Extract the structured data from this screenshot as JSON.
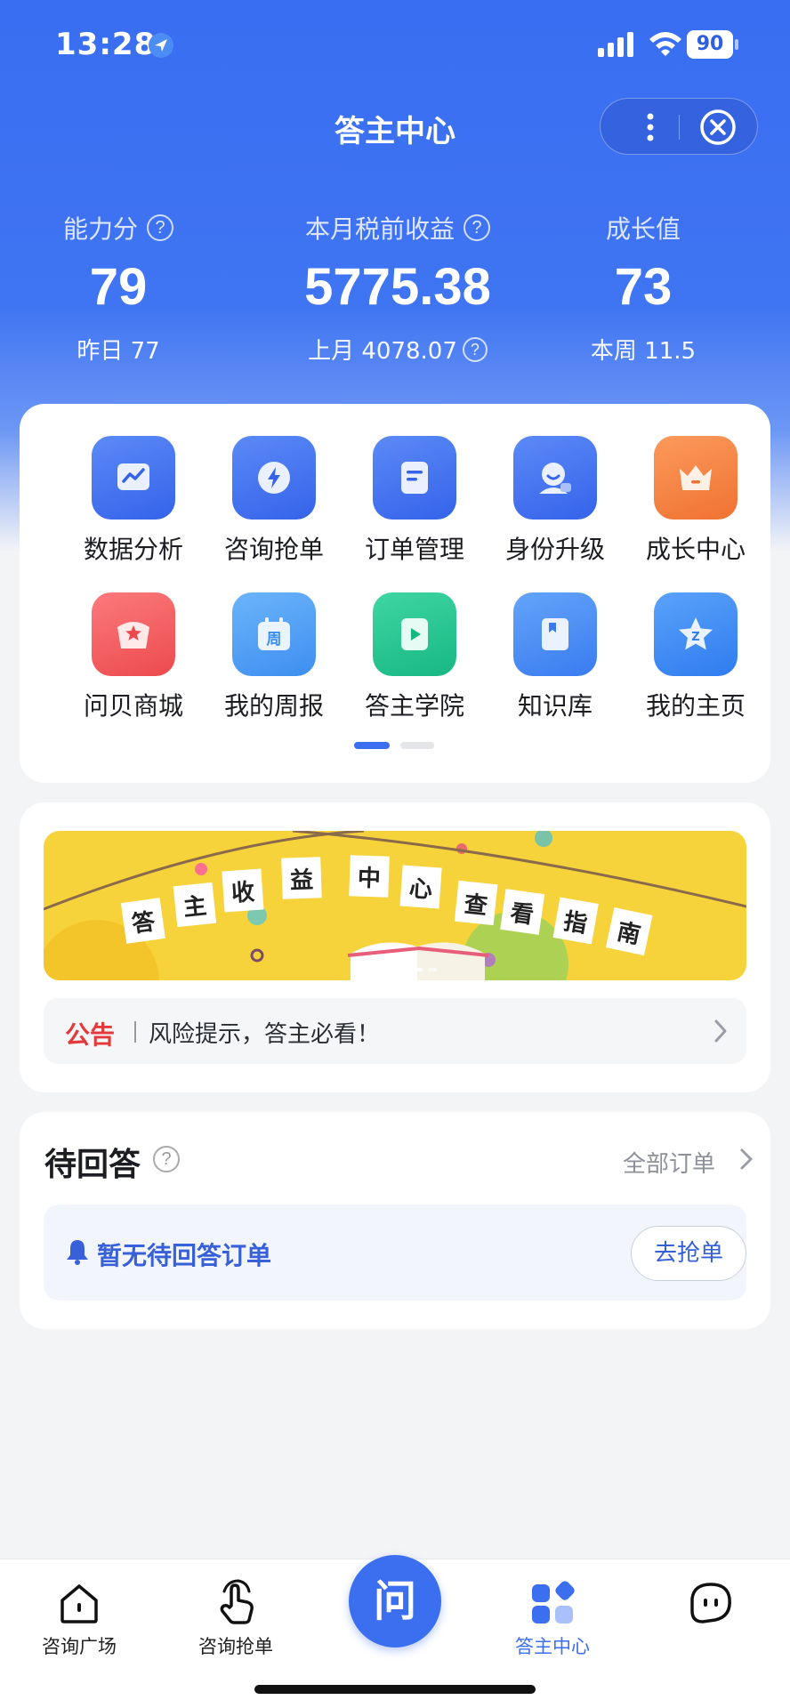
{
  "status_bar": {
    "time": "13:28",
    "battery": "90"
  },
  "nav": {
    "title": "答主中心"
  },
  "stats": [
    {
      "label": "能力分",
      "value": "79",
      "sub": "昨日 77"
    },
    {
      "label": "本月税前收益",
      "value": "5775.38",
      "sub": "上月 4078.07"
    },
    {
      "label": "成长值",
      "value": "73",
      "sub": "本周 11.5"
    }
  ],
  "grid": [
    {
      "label": "数据分析",
      "icon": "chart-icon",
      "color": "#3f6ef0"
    },
    {
      "label": "咨询抢单",
      "icon": "lightning-icon",
      "color": "#3f6ef0"
    },
    {
      "label": "订单管理",
      "icon": "document-icon",
      "color": "#3f6ef0"
    },
    {
      "label": "身份升级",
      "icon": "user-badge-icon",
      "color": "#3f6ef0"
    },
    {
      "label": "成长中心",
      "icon": "crown-icon",
      "color": "#f4803c"
    },
    {
      "label": "问贝商城",
      "icon": "gift-icon",
      "color": "#f0595c"
    },
    {
      "label": "我的周报",
      "icon": "calendar-icon",
      "color": "#4a9cf2"
    },
    {
      "label": "答主学院",
      "icon": "play-icon",
      "color": "#1fc38d"
    },
    {
      "label": "知识库",
      "icon": "book-icon",
      "color": "#4a8ef2"
    },
    {
      "label": "我的主页",
      "icon": "star-icon",
      "color": "#3f88f2"
    }
  ],
  "banner": {
    "chars": [
      "答",
      "主",
      "收",
      "益",
      "中",
      "心",
      "查",
      "看",
      "指",
      "南"
    ]
  },
  "notice": {
    "tag": "公告",
    "text": "风险提示，答主必看！"
  },
  "pending": {
    "title": "待回答",
    "all_orders": "全部订单",
    "empty_message": "暂无待回答订单",
    "grab_button": "去抢单"
  },
  "tabbar": {
    "tabs": [
      {
        "label": "咨询广场"
      },
      {
        "label": "咨询抢单"
      },
      {
        "label": "答主中心"
      },
      {
        "label": ""
      }
    ],
    "center_label": "问",
    "active_color": "#3c6ef0"
  }
}
